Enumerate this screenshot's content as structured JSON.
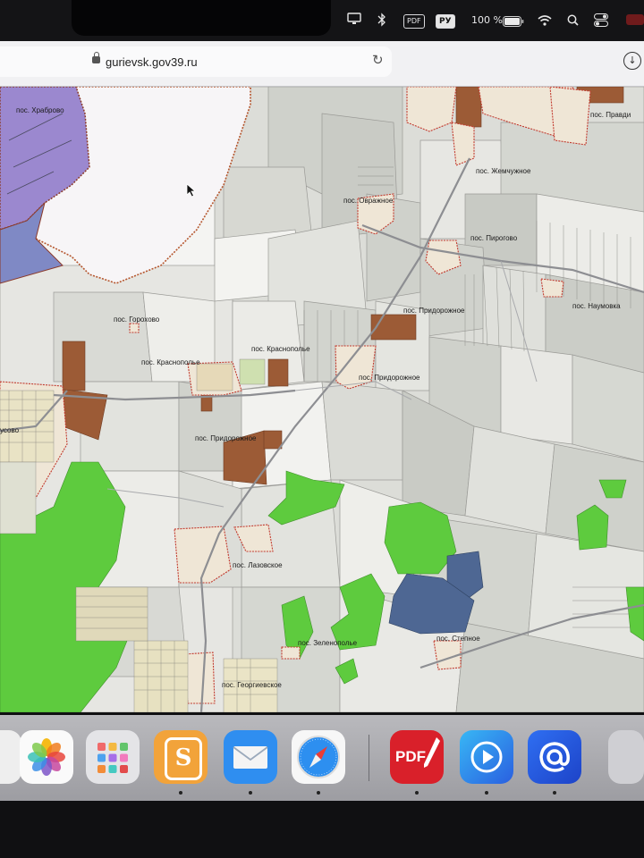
{
  "menubar": {
    "pdf_badge": "PDF",
    "keyboard_layout": "РУ",
    "battery_percent": "100 %",
    "battery_level": 1.0
  },
  "browser": {
    "url": "gurievsk.gov39.ru"
  },
  "map": {
    "labels": {
      "khrabrovo": "пос. Храброво",
      "zhemchuzhnoe": "пос. Жемчужное",
      "ovrazhnoe": "пос. Овражное",
      "pirogovo": "пос. Пирогово",
      "naumovka": "пос. Наумовка",
      "pridorozhnoe_1": "пос. Придорожное",
      "gorokhovo": "пос. Горохово",
      "krasnopolie_1": "пос. Краснополье",
      "krasnopolie_2": "пос. Краснополье",
      "pridorozhnoe_2": "пос. Придорожное",
      "pridorozhnoe_3": "пос. Придорожное",
      "lazovskoe": "пос. Лазовское",
      "zelenopolie": "пос. Зеленополье",
      "stepnoe": "пос. Степное",
      "georgievskoe": "пос. Георгиевское",
      "pravdino": "пос. Правди",
      "usovo": "усово"
    }
  },
  "dock": {
    "scriptable_letter": "S",
    "pdf_app_label": "PDF"
  }
}
